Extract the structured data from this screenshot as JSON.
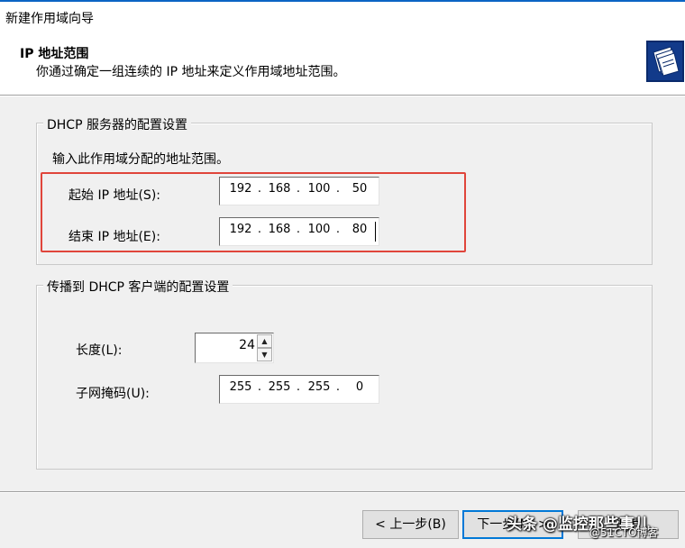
{
  "window": {
    "title": "新建作用域向导"
  },
  "header": {
    "title": "IP 地址范围",
    "description": "你通过确定一组连续的 IP 地址来定义作用域地址范围。",
    "icon": "folder-files-icon"
  },
  "server_group": {
    "legend": "DHCP 服务器的配置设置",
    "instruction": "输入此作用域分配的地址范围。",
    "start_ip": {
      "label": "起始 IP 地址(S):",
      "octets": [
        "192",
        "168",
        "100",
        "50"
      ]
    },
    "end_ip": {
      "label": "结束 IP 地址(E):",
      "octets": [
        "192",
        "168",
        "100",
        "80"
      ]
    }
  },
  "client_group": {
    "legend": "传播到 DHCP 客户端的配置设置",
    "length": {
      "label": "长度(L):",
      "value": "24"
    },
    "mask": {
      "label": "子网掩码(U):",
      "octets": [
        "255",
        "255",
        "255",
        "0"
      ]
    }
  },
  "buttons": {
    "back": "< 上一步(B)",
    "next": "下一步(N) >",
    "cancel": "取消"
  },
  "watermark": {
    "main": "头条 @监控那些事儿",
    "sub": "@51CTO博客"
  },
  "colors": {
    "highlight_box": "#e0453b",
    "default_button_border": "#0078d7"
  }
}
